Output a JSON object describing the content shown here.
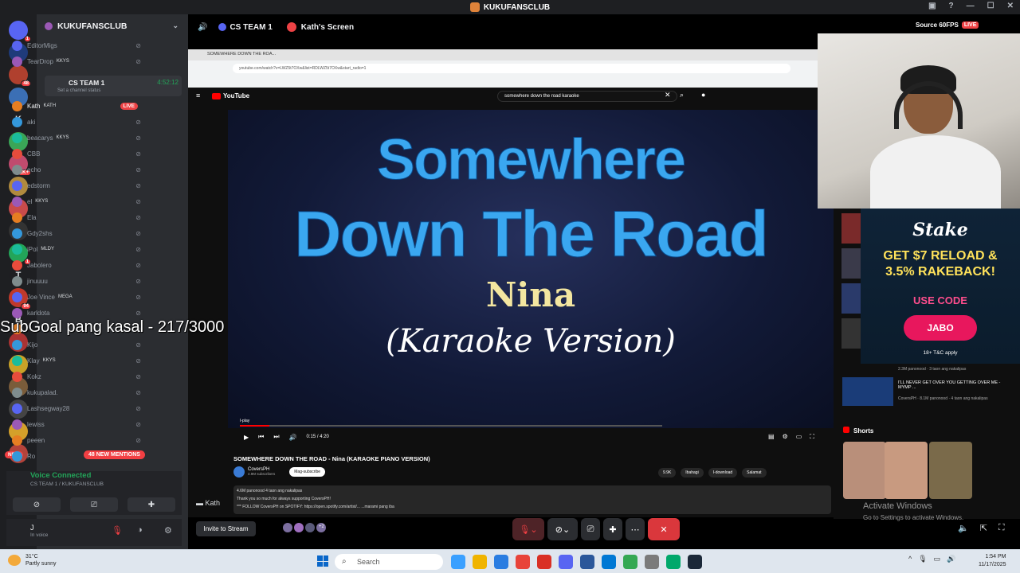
{
  "window": {
    "title": "KUKUFANSCLUB"
  },
  "servers": [
    {
      "label": "",
      "badge": "1",
      "color": "#5865f2"
    },
    {
      "label": "",
      "badge": "",
      "color": "#1f3b7a"
    },
    {
      "label": "",
      "badge": "48",
      "color": "#b0402e"
    },
    {
      "label": "",
      "badge": "",
      "color": "#3b6fb5"
    },
    {
      "label": "K",
      "badge": "",
      "color": "#1e1f22"
    },
    {
      "label": "",
      "badge": "",
      "color": "#3aa657"
    },
    {
      "label": "",
      "badge": "1K+",
      "color": "#c04b6e"
    },
    {
      "label": "",
      "badge": "",
      "color": "#b08a3e"
    },
    {
      "label": "",
      "badge": "",
      "color": "#c94b4b"
    },
    {
      "label": "",
      "badge": "",
      "color": "#333"
    },
    {
      "label": "",
      "badge": "1",
      "color": "#23a559"
    },
    {
      "label": "T",
      "badge": "",
      "color": "#1e1f22"
    },
    {
      "label": "",
      "badge": "94",
      "color": "#c0392b"
    },
    {
      "label": "B",
      "badge": "",
      "color": "#1e1f22"
    },
    {
      "label": "",
      "badge": "",
      "color": "#aa3333"
    },
    {
      "label": "",
      "badge": "",
      "color": "#c9a227"
    },
    {
      "label": "",
      "badge": "",
      "color": "#7a5c3a"
    },
    {
      "label": "",
      "badge": "",
      "color": "#444"
    },
    {
      "label": "",
      "badge": "",
      "color": "#d4a02a"
    },
    {
      "label": "",
      "badge": "",
      "color": "#b4433b"
    }
  ],
  "servers_new": "NEW",
  "guild": {
    "name": "KUKUFANSCLUB"
  },
  "voice_channel": {
    "name": "CS TEAM 1",
    "status": "Set a channel status",
    "timer": "4:52:12"
  },
  "users_top": [
    {
      "name": "EditorMigs",
      "tag": ""
    },
    {
      "name": "TearDrop",
      "tag": "KKYS"
    }
  ],
  "users": [
    {
      "name": "Kath",
      "tag": "KATH",
      "live": "LIVE"
    },
    {
      "name": "aki",
      "tag": ""
    },
    {
      "name": "beacarys",
      "tag": "KKYS"
    },
    {
      "name": "CBB",
      "tag": ""
    },
    {
      "name": "echo",
      "tag": ""
    },
    {
      "name": "edstorm",
      "tag": ""
    },
    {
      "name": "el",
      "tag": "KKYS"
    },
    {
      "name": "Ela",
      "tag": ""
    },
    {
      "name": "Gdy2shs",
      "tag": ""
    },
    {
      "name": "iPol",
      "tag": "MLDY"
    },
    {
      "name": "Jabolero",
      "tag": ""
    },
    {
      "name": "jinuuuu",
      "tag": ""
    },
    {
      "name": "Joe Vince",
      "tag": "MEGA"
    },
    {
      "name": "karldota",
      "tag": ""
    },
    {
      "name": "",
      "tag": ""
    },
    {
      "name": "Kijo",
      "tag": ""
    },
    {
      "name": "Klay",
      "tag": "KKYS"
    },
    {
      "name": "Kokz",
      "tag": ""
    },
    {
      "name": "kukupalad.",
      "tag": ""
    },
    {
      "name": "Lashsegway28",
      "tag": ""
    },
    {
      "name": "lewiss",
      "tag": ""
    },
    {
      "name": "peeen",
      "tag": ""
    },
    {
      "name": "Ro",
      "tag": ""
    }
  ],
  "mentions": "48 NEW MENTIONS",
  "subgoal": "SubGoal pang kasal - 217/3000",
  "voice": {
    "title": "Voice Connected",
    "sub": "CS TEAM 1 / KUKUFANSCLUB"
  },
  "me": {
    "name": "J",
    "status": "In voice"
  },
  "stage": {
    "channel": "CS TEAM 1",
    "screen": "Kath's Screen",
    "source": "Source 60FPS",
    "live": "LIVE"
  },
  "browser": {
    "tab": "SOMEWHERE DOWN THE ROA...",
    "url": "youtube.com/watch?v=LWZ5t7OXw&list=RDLWZ5t7OXw&start_radio=1"
  },
  "youtube": {
    "logo": "YouTube",
    "search": "somewhere down the road karaoke",
    "video_line1": "Somewhere",
    "video_line2": "Down The Road",
    "video_line3": "Nina",
    "video_line4": "(Karaoke Version)",
    "iplay": "I-play",
    "progress": 0.07,
    "time": "0:15 / 4:20",
    "title": "SOMEWHERE DOWN THE ROAD - Nina (KARAOKE PIANO VERSION)",
    "channel": "CoversPH",
    "subs": "4.9M subscribers",
    "subscribe": "Mag-subscribe",
    "likes": "9.9K",
    "share": "Ibahagi",
    "download": "I-download",
    "thanks": "Salamat",
    "desc1": "4.6M panonood  4 taon ang nakalipas",
    "desc2": "Thank you so much for always supporting CoversPH!",
    "desc3": "*** FOLLOW CoversPH on SPOTIFY: https://open.spotify.com/artist/...   ...marami pang iba"
  },
  "ad": {
    "brand": "Stake",
    "headline1": "GET $7 RELOAD &",
    "headline2": "3.5% RAKEBACK!",
    "code_label": "USE CODE",
    "code": "JABO",
    "tc": "18+ T&C apply"
  },
  "recs": [
    {
      "title": "",
      "meta": "2.3M panonood · 3 taon ang nakalipas"
    },
    {
      "title": "I'LL NEVER GET OVER YOU GETTING OVER ME - MYMP ...",
      "meta": "CoversPH · 8.1M panonood · 4 taon ang nakalipas"
    }
  ],
  "shorts": "Shorts",
  "watermark": {
    "line1": "Activate Windows",
    "line2": "Go to Settings to activate Windows."
  },
  "kath_label": "Kath",
  "invite": "Invite to Stream",
  "invite_count": "+2",
  "taskbar": {
    "temp": "31°C",
    "weather": "Partly sunny",
    "search": "Search",
    "time": "1:54 PM",
    "date": "11/17/2025"
  }
}
